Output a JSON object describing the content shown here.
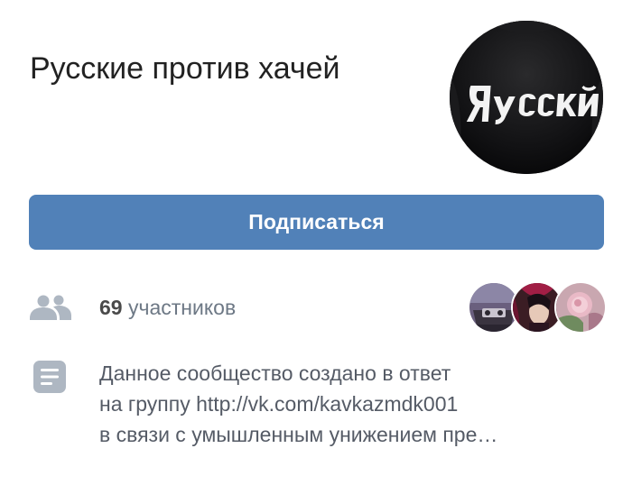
{
  "group": {
    "title": "Русские против хачей",
    "avatar_text": "Ярусский"
  },
  "actions": {
    "subscribe_label": "Подписаться"
  },
  "members": {
    "count": "69",
    "label": "участников",
    "icon": "people-icon",
    "preview_avatars": [
      "member-avatar-1",
      "member-avatar-2",
      "member-avatar-3"
    ]
  },
  "description": {
    "icon": "document-icon",
    "lines": [
      "Данное сообщество создано в ответ",
      "на группу http://vk.com/kavkazmdk001",
      "в связи с умышленным унижением пре…"
    ]
  },
  "colors": {
    "accent": "#5181b8",
    "text_primary": "#222222",
    "text_secondary": "#6d7885",
    "icon_gray": "#aeb7c2"
  }
}
